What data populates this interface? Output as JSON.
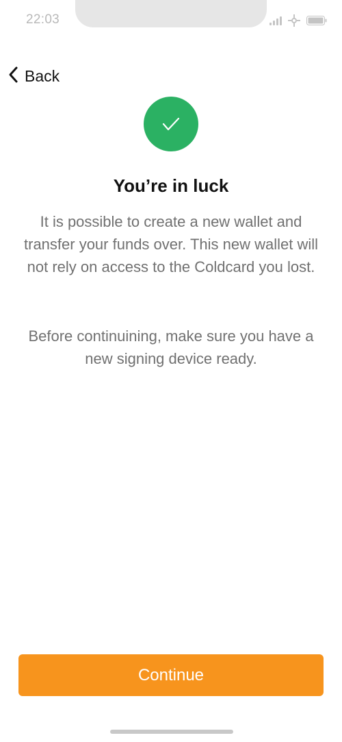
{
  "status_bar": {
    "time": "22:03",
    "icons": [
      "signal-icon",
      "wifi-icon",
      "battery-icon"
    ]
  },
  "nav": {
    "back_label": "Back",
    "back_icon": "chevron-left-icon"
  },
  "content": {
    "icon": "checkmark-icon",
    "icon_color": "#2bb163",
    "title": "You’re in luck",
    "paragraph_1": "It is possible to create a new wallet and transfer your funds over. This new wallet will not rely on access to the Coldcard you lost.",
    "paragraph_2": "Before continuining, make sure you have a new signing device ready."
  },
  "footer": {
    "continue_label": "Continue",
    "button_color": "#f7941d"
  }
}
